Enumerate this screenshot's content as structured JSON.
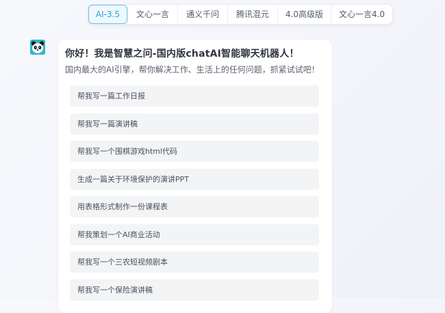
{
  "model_tabs": [
    {
      "label": "AI-3.5",
      "active": true
    },
    {
      "label": "文心一言",
      "active": false
    },
    {
      "label": "通义千问",
      "active": false
    },
    {
      "label": "腾讯混元",
      "active": false
    },
    {
      "label": "4.0高级版",
      "active": false
    },
    {
      "label": "文心一言4.0",
      "active": false
    }
  ],
  "assistant": {
    "avatar_icon": "panda-icon",
    "greeting_title": "你好！我是智慧之问-国内版chatAI智能聊天机器人！",
    "greeting_subtitle": "国内最大的AI引擎，帮你解决工作、生活上的任何问题，抓紧试试吧！"
  },
  "suggestions": [
    "帮我写一篇工作日报",
    "帮我写一篇演讲稿",
    "帮我写一个围棋游戏html代码",
    "生成一篇关于环境保护的演讲PPT",
    "用表格形式制作一份课程表",
    "帮我策划一个AI商业活动",
    "帮我写一个三农短视频剧本",
    "帮我写一个保险演讲稿"
  ],
  "colors": {
    "accent": "#2ba3d6",
    "avatar_bg": "#31b8c4"
  }
}
